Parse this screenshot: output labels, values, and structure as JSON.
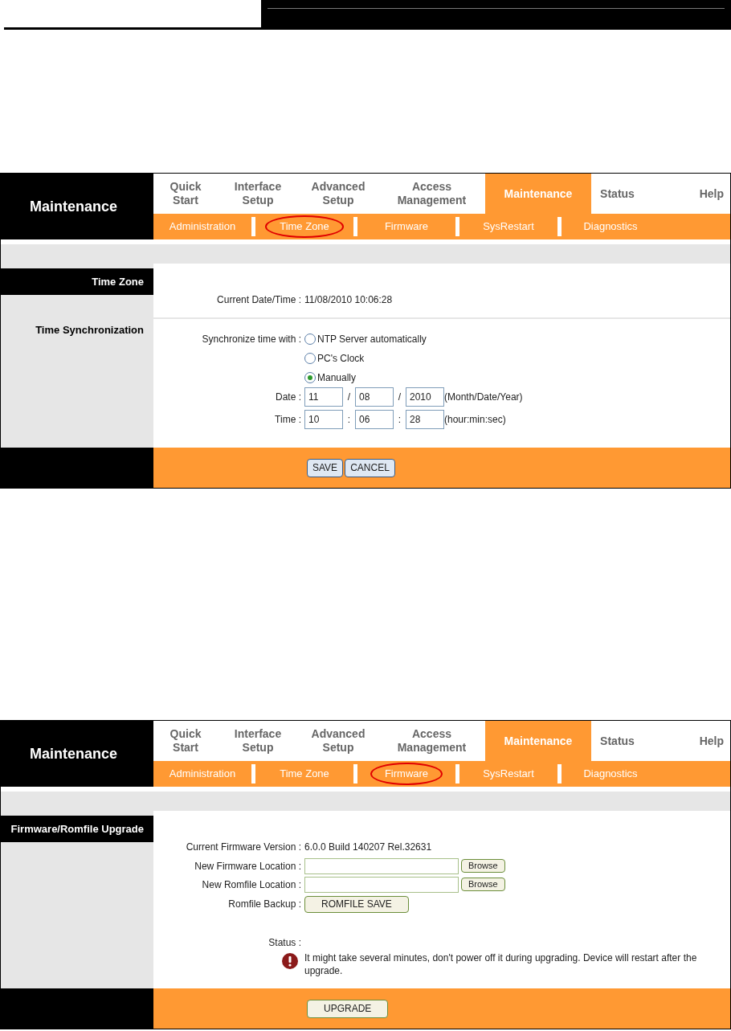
{
  "screens": [
    {
      "title": "Maintenance",
      "tabs": [
        {
          "label": "Quick Start",
          "selected": false
        },
        {
          "label": "Interface Setup",
          "selected": false
        },
        {
          "label": "Advanced Setup",
          "selected": false
        },
        {
          "label": "Access Management",
          "selected": false
        },
        {
          "label": "Maintenance",
          "selected": true
        },
        {
          "label": "Status",
          "selected": false
        },
        {
          "label": "Help",
          "selected": false
        }
      ],
      "subtabs": [
        {
          "label": "Administration",
          "selected": false
        },
        {
          "label": "Time Zone",
          "selected": true
        },
        {
          "label": "Firmware",
          "selected": false
        },
        {
          "label": "SysRestart",
          "selected": false
        },
        {
          "label": "Diagnostics",
          "selected": false
        }
      ],
      "sections": [
        {
          "heading": "Time Zone",
          "rows": [
            {
              "kind": "text",
              "label": "Current Date/Time :",
              "value": "11/08/2010 10:06:28"
            }
          ]
        },
        {
          "heading": "Time Synchronization",
          "rows": [
            {
              "kind": "radio",
              "label": "Synchronize time with :",
              "options": [
                {
                  "label": "NTP Server automatically",
                  "selected": false
                },
                {
                  "label": "PC's Clock",
                  "selected": false
                },
                {
                  "label": "Manually",
                  "selected": true
                }
              ]
            },
            {
              "kind": "triple",
              "label": "Date :",
              "values": [
                "11",
                "08",
                "2010"
              ],
              "separators": [
                "/",
                "/"
              ],
              "hint": "(Month/Date/Year)"
            },
            {
              "kind": "triple",
              "label": "Time :",
              "values": [
                "10",
                "06",
                "28"
              ],
              "separators": [
                ":",
                ":"
              ],
              "hint": "(hour:min:sec)"
            }
          ]
        }
      ],
      "buttons": [
        "SAVE",
        "CANCEL"
      ]
    },
    {
      "title": "Maintenance",
      "tabs": [
        {
          "label": "Quick Start",
          "selected": false
        },
        {
          "label": "Interface Setup",
          "selected": false
        },
        {
          "label": "Advanced Setup",
          "selected": false
        },
        {
          "label": "Access Management",
          "selected": false
        },
        {
          "label": "Maintenance",
          "selected": true
        },
        {
          "label": "Status",
          "selected": false
        },
        {
          "label": "Help",
          "selected": false
        }
      ],
      "subtabs": [
        {
          "label": "Administration",
          "selected": false
        },
        {
          "label": "Time Zone",
          "selected": false
        },
        {
          "label": "Firmware",
          "selected": true
        },
        {
          "label": "SysRestart",
          "selected": false
        },
        {
          "label": "Diagnostics",
          "selected": false
        }
      ],
      "sections": [
        {
          "heading": "Firmware/Romfile Upgrade",
          "rows": [
            {
              "kind": "text",
              "label": "Current Firmware Version :",
              "value": "6.0.0 Build 140207 Rel.32631"
            },
            {
              "kind": "file",
              "label": "New Firmware Location :",
              "button": "Browse"
            },
            {
              "kind": "file",
              "label": "New Romfile Location :",
              "button": "Browse"
            },
            {
              "kind": "button",
              "label": "Romfile Backup :",
              "button": "ROMFILE SAVE"
            },
            {
              "kind": "status",
              "label": "Status :",
              "message": "It might take several minutes, don't power off it during upgrading. Device will restart after the upgrade."
            }
          ]
        }
      ],
      "buttons": [
        "UPGRADE"
      ]
    }
  ]
}
